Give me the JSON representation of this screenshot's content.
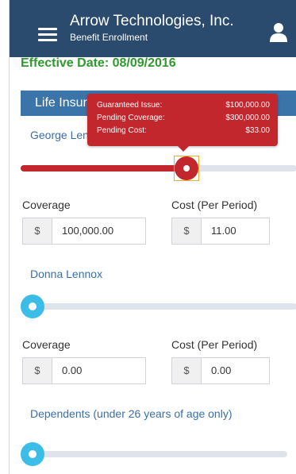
{
  "header": {
    "title": "Arrow Technologies, Inc.",
    "subtitle": "Benefit Enrollment"
  },
  "effective_date": "Effective Date: 08/09/2016",
  "section": {
    "title": "Life Insurance"
  },
  "members": [
    {
      "name": "George Lennox",
      "slider_fraction": 0.6,
      "coverage_label": "Coverage",
      "coverage_prefix": "$",
      "coverage_value": "100,000.00",
      "cost_label": "Cost (Per Period)",
      "cost_prefix": "$",
      "cost_value": "11.00"
    },
    {
      "name": "Donna Lennox",
      "slider_fraction": 0,
      "coverage_label": "Coverage",
      "coverage_prefix": "$",
      "coverage_value": "0.00",
      "cost_label": "Cost (Per Period)",
      "cost_prefix": "$",
      "cost_value": "0.00"
    },
    {
      "name": "Dependents (under 26 years of age only)",
      "slider_fraction": 0
    }
  ],
  "tooltip": {
    "rows": [
      {
        "label": "Guaranteed Issue:",
        "value": "$100,000.00"
      },
      {
        "label": "Pending Coverage:",
        "value": "$300,000.00"
      },
      {
        "label": "Pending Cost:",
        "value": "$33.00"
      }
    ]
  },
  "colors": {
    "header_bg": "#2a4a6e",
    "section_bg": "#3a74a8",
    "accent_red": "#c1272d",
    "accent_blue": "#3bbde7",
    "date_green": "#2e9a2e"
  },
  "icons": {
    "menu": "hamburger-menu-icon",
    "user": "user-profile-icon"
  }
}
